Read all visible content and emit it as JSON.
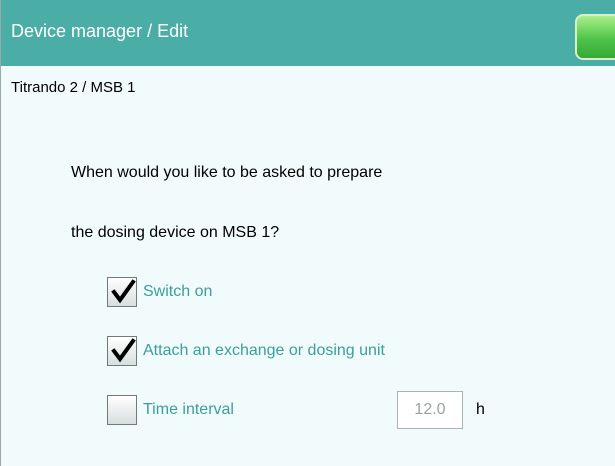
{
  "window": {
    "title": "Device manager / Edit"
  },
  "header": {
    "subtitle": "Titrando 2 / MSB 1"
  },
  "main": {
    "question_line1": "When would you like to be asked to prepare",
    "question_line2": "the dosing device on MSB 1?",
    "options": [
      {
        "label": "Switch on",
        "checked": true
      },
      {
        "label": "Attach an exchange or dosing unit",
        "checked": true
      },
      {
        "label": "Time interval",
        "checked": false
      }
    ],
    "time_interval": {
      "value": "12.0",
      "unit": "h"
    }
  },
  "colors": {
    "titlebar": "#4aada6",
    "accent_text": "#3a9f9a",
    "background": "#f2fbfb"
  },
  "icons": {
    "ok_button": "green-confirm-button",
    "check": "checkmark-icon"
  }
}
